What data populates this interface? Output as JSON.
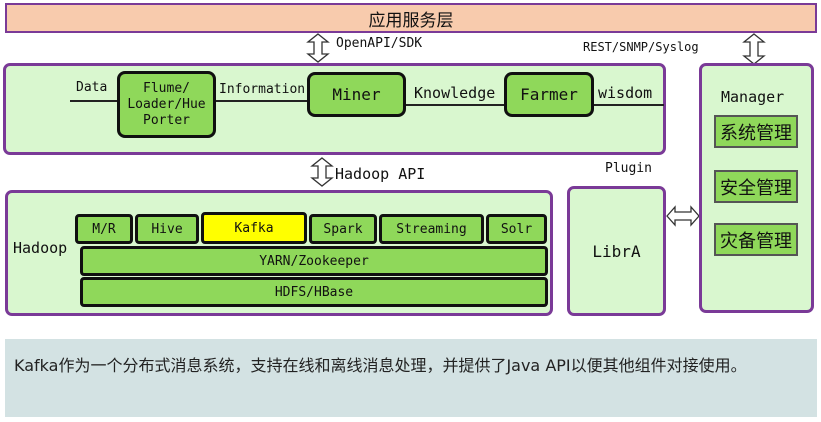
{
  "app_layer": {
    "title": "应用服务层"
  },
  "interfaces": {
    "openapi": "OpenAPI/SDK",
    "rest": "REST/SNMP/Syslog",
    "hadoop_api": "Hadoop API",
    "plugin": "Plugin"
  },
  "pipeline": {
    "data_label": "Data",
    "flume_box": "Flume/\nLoader/Hue\nPorter",
    "information_label": "Information",
    "miner_box": "Miner",
    "knowledge_label": "Knowledge",
    "farmer_box": "Farmer",
    "wisdom_label": "wisdom"
  },
  "manager": {
    "title": "Manager",
    "items": [
      "系统管理",
      "安全管理",
      "灾备管理"
    ]
  },
  "hadoop": {
    "title": "Hadoop",
    "components": [
      "M/R",
      "Hive",
      "Kafka",
      "Spark",
      "Streaming",
      "Solr"
    ],
    "highlighted": "Kafka",
    "yarn": "YARN/Zookeeper",
    "hdfs": "HDFS/HBase"
  },
  "libra": {
    "title": "LibrA"
  },
  "description": "Kafka作为一个分布式消息系统，支持在线和离线消息处理，并提供了Java API以便其他组件对接使用。",
  "colors": {
    "panel_bg": "#d9f7cf",
    "panel_border": "#7a3a97",
    "box_green": "#8fd85a",
    "highlight_yellow": "#ffff00",
    "app_layer_bg": "#f8cbad",
    "caption_bg": "#d3e2e3"
  }
}
